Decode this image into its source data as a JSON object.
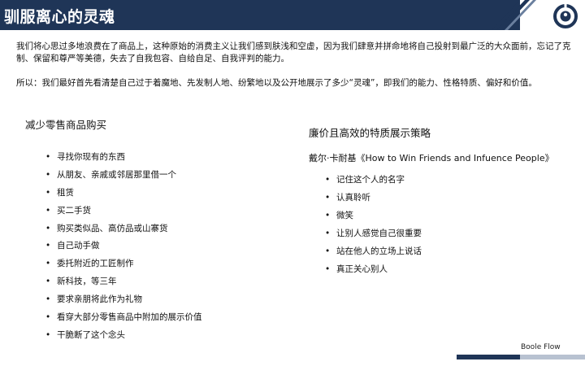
{
  "header": {
    "title": "驯服离心的灵魂",
    "bar_color": "#1f3557",
    "accent_color": "#6a7f9e"
  },
  "logo": {
    "icon": "boole-flow-logo-icon",
    "color": "#1f3557"
  },
  "intro": {
    "paragraph_1": "我们将心思过多地浪费在了商品上，这种原始的消费主义让我们感到肤浅和空虚，因为我们肆意并拼命地将自己投射到最广泛的大众面前，忘记了克制、保留和尊严等美德，失去了自我包容、自给自足、自我评判的能力。",
    "paragraph_2": "所以：我们最好首先看清楚自己过于着魔地、先发制人地、纷繁地以及公开地展示了多少“灵魂”，即我们的能力、性格特质、偏好和价值。"
  },
  "left_section": {
    "title": "减少零售商品购买",
    "items": [
      "寻找你现有的东西",
      "从朋友、亲戚或邻居那里借一个",
      "租赁",
      "买二手货",
      "购买类似品、高仿品或山寨货",
      "自己动手做",
      "委托附近的工匠制作",
      "新科技，等三年",
      "要求亲朋将此作为礼物",
      "看穿大部分零售商品中附加的展示价值",
      "干脆断了这个念头"
    ]
  },
  "right_section": {
    "title": "廉价且高效的特质展示策略",
    "subheading": "戴尔·卡耐基《How to Win Friends and Infuence People》",
    "items": [
      "记住这个人的名字",
      "认真聆听",
      "微笑",
      "让别人感觉自己很重要",
      "站在他人的立场上说话",
      "真正关心别人"
    ]
  },
  "footer": {
    "brand": "Boole Flow",
    "bar_dark": "#1f3557",
    "bar_light": "#b8c2d1"
  }
}
